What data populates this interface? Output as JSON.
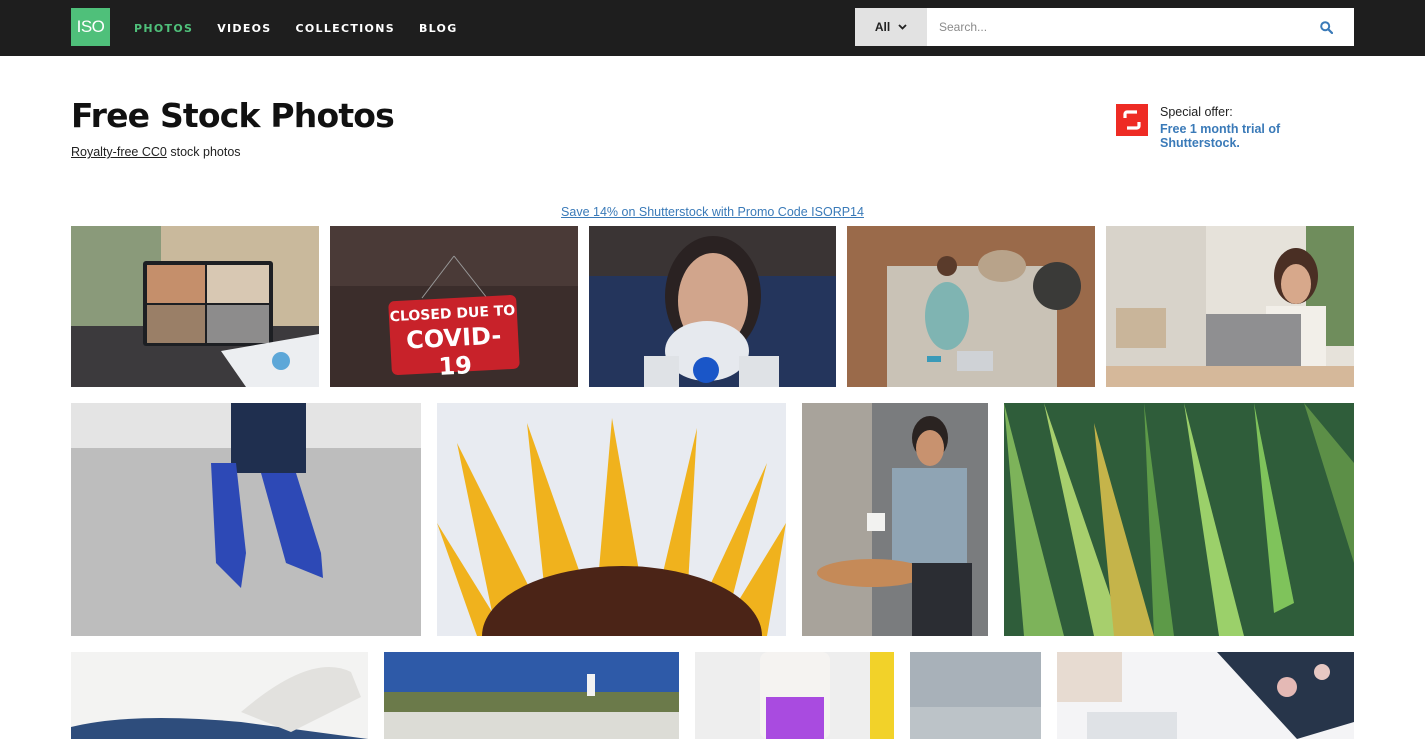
{
  "header": {
    "logo_text": "ISO",
    "nav": [
      {
        "label": "PHOTOS",
        "active": true
      },
      {
        "label": "VIDEOS",
        "active": false
      },
      {
        "label": "COLLECTIONS",
        "active": false
      },
      {
        "label": "BLOG",
        "active": false
      }
    ],
    "search": {
      "category": "All",
      "placeholder": "Search..."
    }
  },
  "page": {
    "title": "Free Stock Photos",
    "subtitle_link": "Royalty-free CC0",
    "subtitle_rest": " stock photos"
  },
  "offer": {
    "line1": "Special offer:",
    "line2": "Free 1 month trial of Shutterstock."
  },
  "promo": {
    "text": "Save 14% on Shutterstock with Promo Code ISORP14"
  },
  "photos": {
    "sign_line1": "CLOSED DUE TO",
    "sign_line2": "COVID-19"
  },
  "colors": {
    "accent": "#4fc07a",
    "link": "#3a7ab8",
    "topbar": "#1e1e1e",
    "offer_icon": "#ee2b24"
  },
  "icons": {
    "search": "search-icon",
    "dropdown": "chevron-down-icon",
    "offer": "shutterstock-icon"
  }
}
